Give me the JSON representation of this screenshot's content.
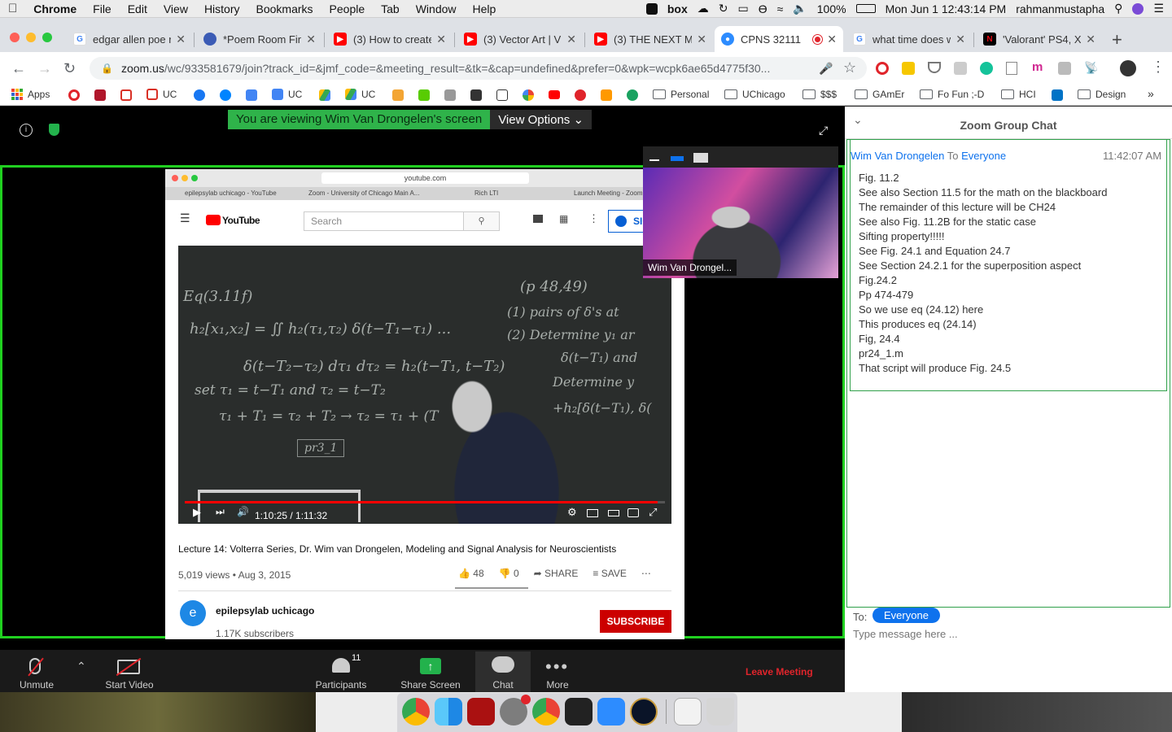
{
  "menubar": {
    "app": "Chrome",
    "items": [
      "File",
      "Edit",
      "View",
      "History",
      "Bookmarks",
      "People",
      "Tab",
      "Window",
      "Help"
    ],
    "box": "box",
    "battery": "100%",
    "datetime": "Mon Jun 1  12:43:14 PM",
    "user": "rahmanmustapha"
  },
  "tabs": [
    {
      "title": "edgar allen poe r",
      "icon": "google-icon",
      "color": "#4285f4"
    },
    {
      "title": "*Poem Room Fin",
      "icon": "globe-icon",
      "color": "#3b5bb5"
    },
    {
      "title": "(3) How to create",
      "icon": "youtube-icon",
      "color": "#ff0000"
    },
    {
      "title": "(3) Vector Art | V",
      "icon": "youtube-icon",
      "color": "#ff0000"
    },
    {
      "title": "(3) THE NEXT M",
      "icon": "youtube-icon",
      "color": "#ff0000"
    },
    {
      "title": "CPNS 32111",
      "icon": "zoom-icon",
      "color": "#2d8cff",
      "active": true
    },
    {
      "title": "what time does w",
      "icon": "google-icon",
      "color": "#4285f4"
    },
    {
      "title": "'Valorant' PS4, X",
      "icon": "netflix-icon",
      "color": "#e50914"
    }
  ],
  "address": {
    "domain": "zoom.us",
    "path": "/wc/933581679/join?track_id=&jmf_code=&meeting_result=&tk=&cap=undefined&prefer=0&wpk=wcpk6ae65d4775f30..."
  },
  "bookmarks": [
    {
      "label": "Apps",
      "type": "apps"
    },
    {
      "label": "UC",
      "type": "gmail"
    },
    {
      "label": "UC",
      "type": "docs"
    },
    {
      "label": "UC",
      "type": "drive"
    },
    {
      "label": "Personal",
      "type": "folder"
    },
    {
      "label": "UChicago",
      "type": "folder"
    },
    {
      "label": "$$$",
      "type": "folder"
    },
    {
      "label": "GAmEr",
      "type": "folder"
    },
    {
      "label": "Fo Fun ;-D",
      "type": "folder"
    },
    {
      "label": "HCI",
      "type": "folder"
    },
    {
      "label": "Design",
      "type": "folder"
    },
    {
      "label": "»",
      "type": "more"
    }
  ],
  "zoom": {
    "banner_text": "You are viewing Wim Van Drongelen's screen",
    "view_options": "View Options",
    "presenter_name": "Wim Van Drongel...",
    "toolbar": {
      "unmute": "Unmute",
      "start_video": "Start Video",
      "participants": "Participants",
      "participants_count": "11",
      "share_screen": "Share Screen",
      "chat": "Chat",
      "more": "More",
      "leave": "Leave Meeting"
    }
  },
  "shared_screen": {
    "url": "youtube.com",
    "tabs": [
      "epilepsylab uchicago - YouTube",
      "Zoom - University of Chicago Main A...",
      "Rich LTI",
      "Launch Meeting - Zoom"
    ],
    "yt_logo": "YouTube",
    "search_placeholder": "Search",
    "sign_in": "SIG",
    "time": "1:10:25 / 1:11:32",
    "progress": 0.984,
    "video_title": "Lecture 14: Volterra Series, Dr. Wim van Drongelen, Modeling and Signal Analysis for Neuroscientists",
    "meta": "5,019 views • Aug 3, 2015",
    "likes": "48",
    "dislikes": "0",
    "share": "SHARE",
    "save": "SAVE",
    "channel_initial": "e",
    "channel": "epilepsylab uchicago",
    "subscribers": "1.17K subscribers",
    "subscribe": "SUBSCRIBE"
  },
  "chat": {
    "title": "Zoom Group Chat",
    "sender": "Wim Van Drongelen",
    "to_word": "To",
    "recipient": "Everyone",
    "timestamp": "11:42:07 AM",
    "messages": [
      "Fig. 11.2",
      "See also Section 11.5 for the math on the blackboard",
      "The remainder of this lecture will be CH24",
      "See also Fig. 11.2B for the static case",
      "Sifting property!!!!!",
      "See Fig. 24.1 and Equation 24.7",
      "See Section 24.2.1 for the superposition aspect",
      "Fig.24.2",
      "Pp 474-479",
      "So we use eq (24.12) here",
      "This produces eq (24.14)",
      "Fig, 24.4",
      "pr24_1.m",
      "That script will produce Fig. 24.5"
    ],
    "to_label": "To:",
    "to_value": "Everyone",
    "input_placeholder": "Type message here ..."
  }
}
